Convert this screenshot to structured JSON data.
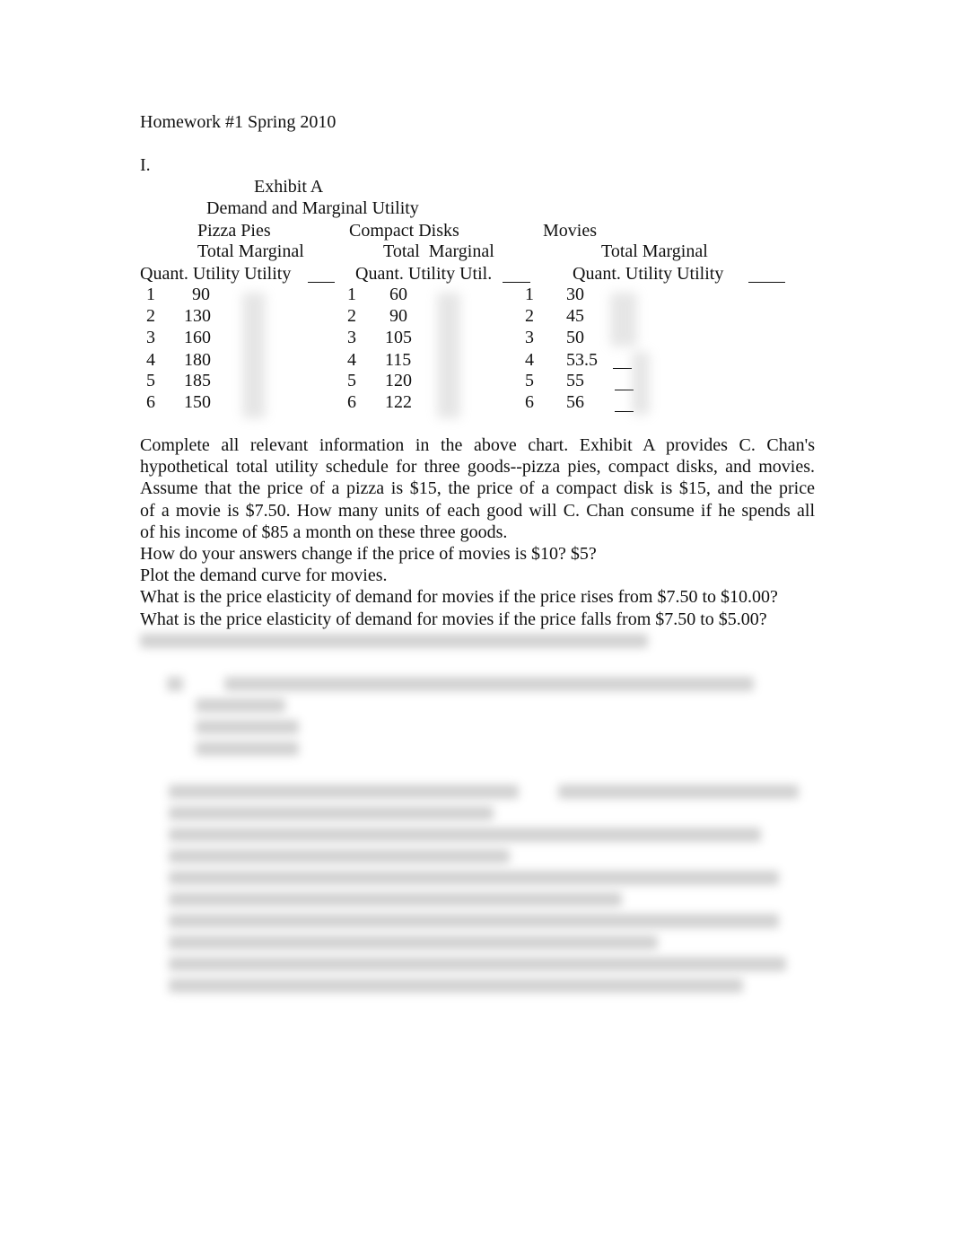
{
  "document": {
    "title": "Homework #1 Spring 2010",
    "section_number": "I.",
    "exhibit": {
      "title": "Exhibit A",
      "subtitle": "Demand and Marginal Utility",
      "goods": [
        {
          "name": "Pizza Pies",
          "header_line1": "Total Marginal",
          "header_line2": "Quant. Utility Utility",
          "rows": [
            {
              "quantity": "1",
              "total_utility": "90"
            },
            {
              "quantity": "2",
              "total_utility": "130"
            },
            {
              "quantity": "3",
              "total_utility": "160"
            },
            {
              "quantity": "4",
              "total_utility": "180"
            },
            {
              "quantity": "5",
              "total_utility": "185"
            },
            {
              "quantity": "6",
              "total_utility": "150"
            }
          ]
        },
        {
          "name": "Compact Disks",
          "header_line1": "Total  Marginal",
          "header_line2": "Quant. Utility Util.",
          "rows": [
            {
              "quantity": "1",
              "total_utility": "60"
            },
            {
              "quantity": "2",
              "total_utility": "90"
            },
            {
              "quantity": "3",
              "total_utility": "105"
            },
            {
              "quantity": "4",
              "total_utility": "115"
            },
            {
              "quantity": "5",
              "total_utility": "120"
            },
            {
              "quantity": "6",
              "total_utility": "122"
            }
          ]
        },
        {
          "name": "Movies",
          "header_line1": "Total Marginal",
          "header_line2": "Quant. Utility Utility",
          "rows": [
            {
              "quantity": "1",
              "total_utility": "30"
            },
            {
              "quantity": "2",
              "total_utility": "45"
            },
            {
              "quantity": "3",
              "total_utility": "50"
            },
            {
              "quantity": "4",
              "total_utility": "53.5"
            },
            {
              "quantity": "5",
              "total_utility": "55"
            },
            {
              "quantity": "6",
              "total_utility": "56"
            }
          ]
        }
      ]
    },
    "paragraph_lines": [
      "Complete all relevant information in the above chart.    Exhibit A provides C. Chan's",
      "hypothetical total utility schedule for three goods--pizza pies, compact disks, and movies.",
      "Assume that the price of a pizza is $15, the price of a compact disk is $15, and the price",
      "of a movie is $7.50.  How many units of each good will C. Chan consume if he spends all",
      "of his income of  $85 a month on these three goods."
    ],
    "questions": [
      "How do your answers change if the price of movies is $10?  $5?",
      "Plot the demand curve for movies.",
      "What is the price elasticity of demand for movies if the price rises from $7.50 to $10.00?",
      "What is the price elasticity of demand for movies if the price falls from $7.50 to $5.00?"
    ]
  }
}
